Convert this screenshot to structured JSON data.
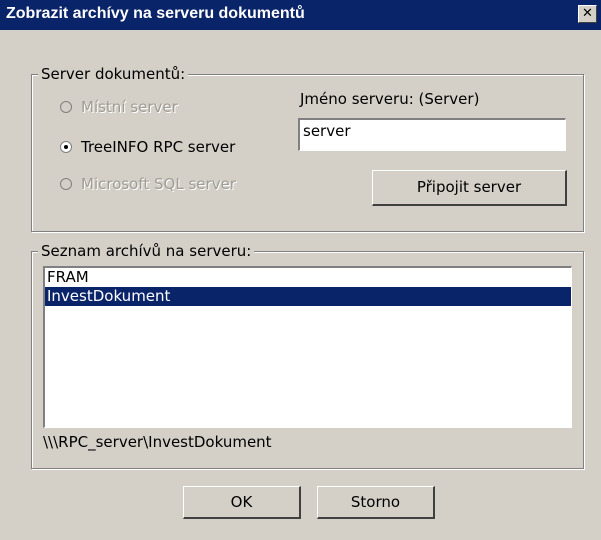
{
  "window": {
    "title": "Zobrazit archívy na serveru dokumentů",
    "close_glyph": "✕"
  },
  "server_group": {
    "legend": "Server dokumentů:",
    "options": [
      {
        "label": "Místní server",
        "checked": false,
        "enabled": false
      },
      {
        "label": "TreeINFO RPC server",
        "checked": true,
        "enabled": true
      },
      {
        "label": "Microsoft SQL server",
        "checked": false,
        "enabled": false
      }
    ],
    "server_name_label": "Jméno serveru: (Server)",
    "server_name_value": "server",
    "connect_button": "Připojit server"
  },
  "archive_group": {
    "legend": "Seznam archívů na serveru:",
    "items": [
      {
        "label": "FRAM",
        "selected": false
      },
      {
        "label": "InvestDokument",
        "selected": true
      }
    ],
    "path": "\\\\\\RPC_server\\InvestDokument"
  },
  "buttons": {
    "ok": "OK",
    "cancel": "Storno"
  },
  "colors": {
    "dialog_bg": "#d4d0c8",
    "title_bar": "#0a246a",
    "selection": "#0a246a"
  }
}
